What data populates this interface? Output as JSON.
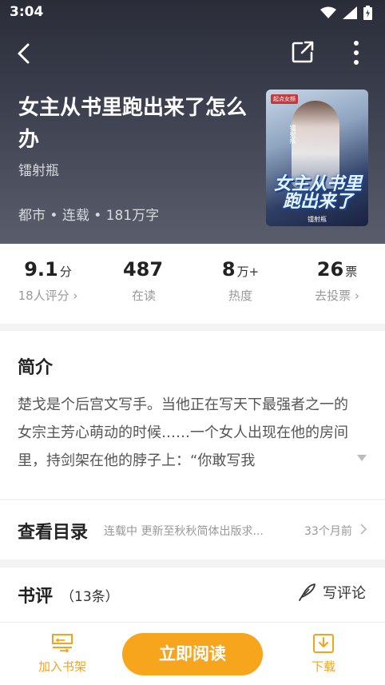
{
  "status_bar": {
    "time": "3:04"
  },
  "book": {
    "title": "女主从书里跑出来了怎么办",
    "author": "镭射瓶",
    "meta": "都市 • 连载 • 181万字",
    "cover": {
      "publisher": "起点女频",
      "title": "女主从书里跑出来了",
      "author": "镭射瓶",
      "vertical_author": "镭射瓶"
    }
  },
  "stats": [
    {
      "value": "9.1",
      "unit": "分",
      "label": "18人评分 ›"
    },
    {
      "value": "487",
      "unit": "",
      "label": "在读"
    },
    {
      "value": "8",
      "unit": "万+",
      "label": "热度"
    },
    {
      "value": "26",
      "unit": "票",
      "label": "去投票 ›"
    }
  ],
  "intro": {
    "heading": "简介",
    "text": "楚戈是个后宫文写手。当他正在写天下最强者之一的女宗主芳心萌动的时候……一个女人出现在他的房间里，持剑架在他的脖子上：“你敢写我"
  },
  "catalog": {
    "heading": "查看目录",
    "status": "连载中 更新至秋秋简体出版求...",
    "time": "33个月前"
  },
  "reviews": {
    "heading": "书评",
    "count": "（13条）",
    "write_label": "写评论"
  },
  "bottom_bar": {
    "shelf_label": "加入书架",
    "read_label": "立即阅读",
    "download_label": "下载"
  },
  "colors": {
    "accent": "#f7a51c",
    "hero_bg": "#3d4150"
  }
}
